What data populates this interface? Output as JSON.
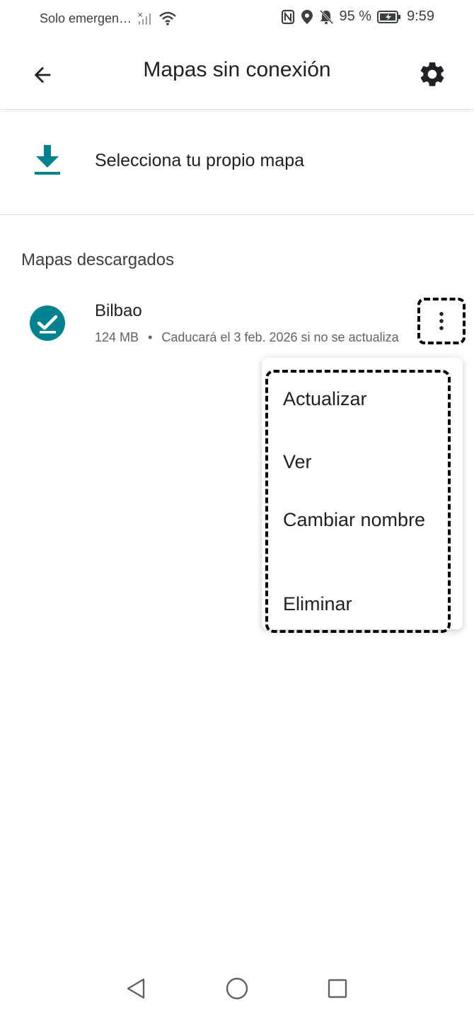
{
  "status_bar": {
    "carrier": "Solo emergen…",
    "battery": "95 %",
    "time": "9:59"
  },
  "app_bar": {
    "title": "Mapas sin conexión"
  },
  "select_map": {
    "label": "Selecciona tu propio mapa"
  },
  "downloaded": {
    "header": "Mapas descargados",
    "maps": [
      {
        "name": "Bilbao",
        "size": "124 MB",
        "separator": "•",
        "expiry": "Caducará el 3 feb. 2026 si no se actualiza"
      }
    ]
  },
  "menu": {
    "items": [
      "Actualizar",
      "Ver",
      "Cambiar nombre",
      "Eliminar"
    ]
  },
  "colors": {
    "accent": "#00838f"
  }
}
